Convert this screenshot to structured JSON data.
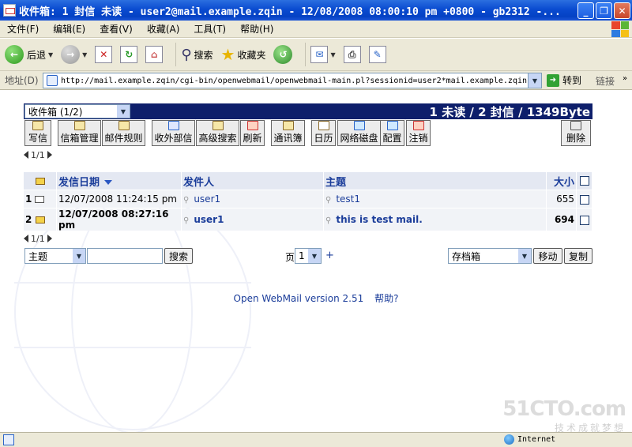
{
  "window": {
    "title": "收件箱: 1 封信 未读 - user2@mail.example.zqin - 12/08/2008 08:00:10 pm +0800 - gb2312 -...",
    "min": "_",
    "max": "❐",
    "close": "✕"
  },
  "menu": [
    "文件(F)",
    "编辑(E)",
    "查看(V)",
    "收藏(A)",
    "工具(T)",
    "帮助(H)"
  ],
  "toolbar": {
    "back": "后退",
    "search": "搜索",
    "favorites": "收藏夹"
  },
  "address": {
    "label": "地址(D)",
    "url": "http://mail.example.zqin/cgi-bin/openwebmail/openwebmail-main.pl?sessionid=user2*mail.example.zqin-",
    "go": "转到",
    "links": "链接"
  },
  "webmail": {
    "folder": "收件箱 (1/2)",
    "stats": "1 未读 / 2 封信 / 1349Byte",
    "buttons": {
      "compose": "写信",
      "folders": "信箱管理",
      "filters": "邮件规则",
      "pop3": "收外部信",
      "advsearch": "高级搜索",
      "refresh": "刷新",
      "addressbook": "通讯簿",
      "calendar": "日历",
      "webdisk": "网络磁盘",
      "prefs": "配置",
      "logout": "注销",
      "trash": "删除"
    },
    "page": "1/1",
    "columns": {
      "date": "发信日期",
      "from": "发件人",
      "subject": "主题",
      "size": "大小"
    },
    "messages": [
      {
        "num": "1",
        "date": "12/07/2008 11:24:15 pm",
        "from": "user1",
        "subject": "test1",
        "size": "655"
      },
      {
        "num": "2",
        "date": "12/07/2008 08:27:16 pm",
        "from": "user1",
        "subject": "this is test mail.",
        "size": "694"
      }
    ],
    "search": {
      "field": "主题",
      "button": "搜索",
      "page_label": "页",
      "page_value": "1",
      "plus": "+",
      "target": "存档箱",
      "move": "移动",
      "copy": "复制"
    },
    "footer": {
      "version": "Open WebMail version 2.51",
      "help": "帮助?"
    }
  },
  "watermark": {
    "logo": "51CTO.com",
    "slogan": "技术成就梦想"
  },
  "status": {
    "zone": "Internet"
  }
}
